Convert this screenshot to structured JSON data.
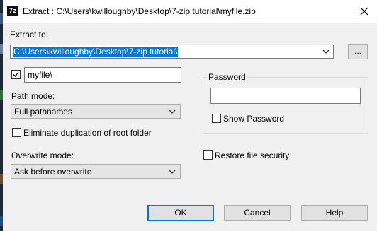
{
  "window": {
    "title": "Extract : C:\\Users\\kwilloughby\\Desktop\\7-zip tutorial\\myfile.zip",
    "app_icon_text": "7z"
  },
  "extract_to": {
    "label": "Extract to:",
    "path_value": "C:\\Users\\kwilloughby\\Desktop\\7-zip tutorial\\",
    "browse_label": "..."
  },
  "subfolder": {
    "checked": true,
    "value": "myfile\\"
  },
  "path_mode": {
    "label": "Path mode:",
    "selected": "Full pathnames"
  },
  "eliminate_duplication": {
    "label": "Eliminate duplication of root folder",
    "checked": false
  },
  "overwrite_mode": {
    "label": "Overwrite mode:",
    "selected": "Ask before overwrite"
  },
  "password": {
    "group_label": "Password",
    "value": "",
    "show_password_label": "Show Password",
    "show_password_checked": false
  },
  "restore_security": {
    "label": "Restore file security",
    "checked": false
  },
  "buttons": {
    "ok": "OK",
    "cancel": "Cancel",
    "help": "Help"
  },
  "colors": {
    "selection": "#0078d7",
    "default_button_border": "#0078d7",
    "dialog_background": "#f0f0f0"
  }
}
